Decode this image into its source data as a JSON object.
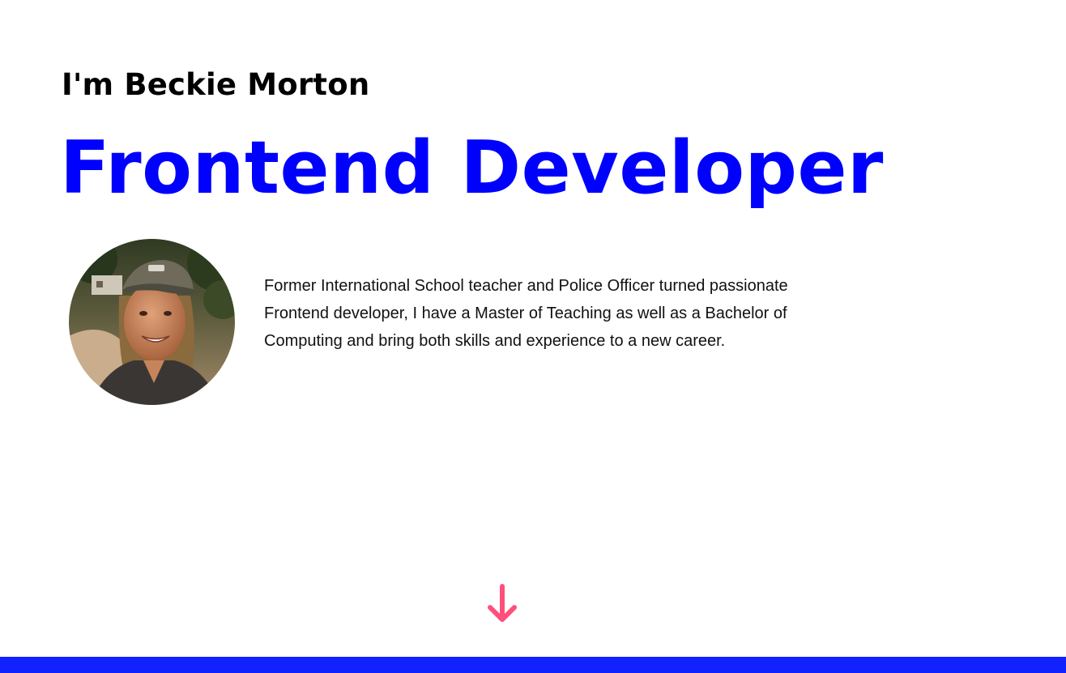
{
  "hero": {
    "intro": "I'm Beckie Morton",
    "role": "Frontend Developer",
    "bio": "Former International School teacher and Police Officer turned passionate Frontend developer, I have a Master of Teaching as well as a Bachelor of Computing and bring both skills and experience to a new career."
  },
  "scroll_down": {
    "icon": "arrow-down-icon",
    "color": "#ff4f7b"
  },
  "colors": {
    "role_text": "#0000ff",
    "footer_bar": "#1122ff"
  }
}
